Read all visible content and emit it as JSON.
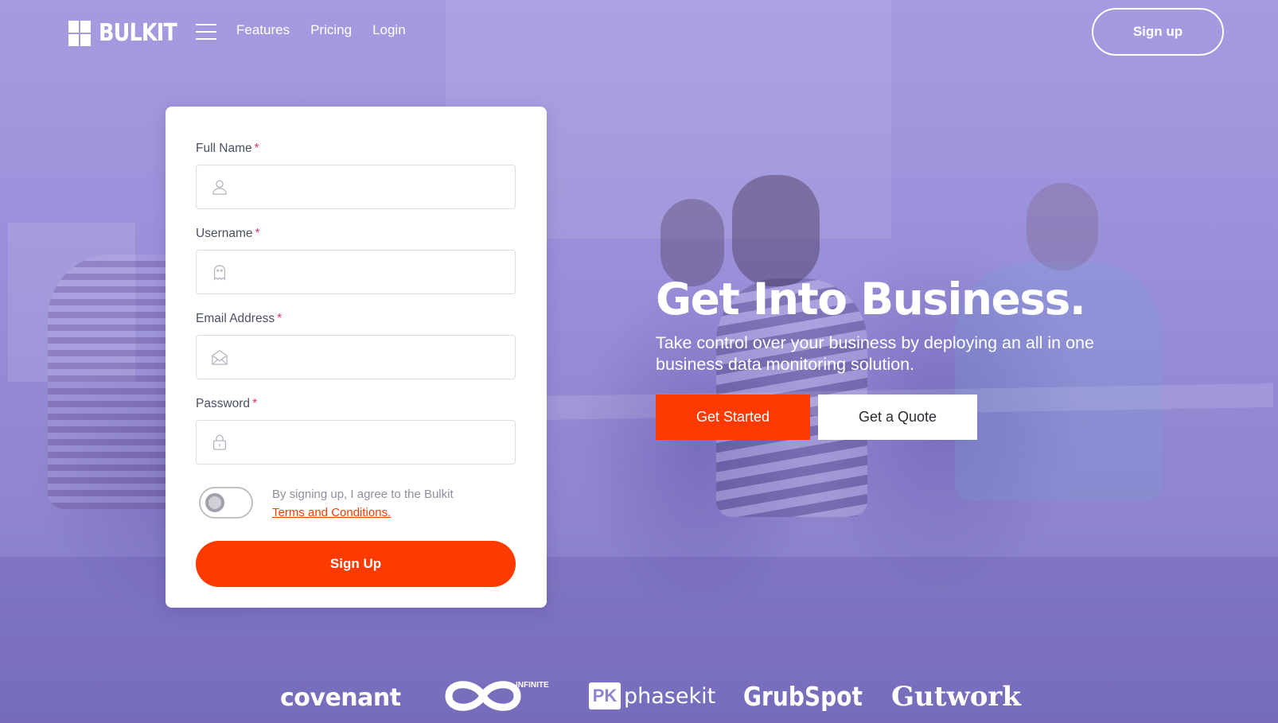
{
  "nav": {
    "brand": "BULKIT",
    "links": [
      "Features",
      "Pricing",
      "Login"
    ],
    "signup_label": "Sign up"
  },
  "form": {
    "fields": [
      {
        "label": "Full Name",
        "required_mark": "*",
        "icon": "user-icon",
        "value": "",
        "placeholder": ""
      },
      {
        "label": "Username",
        "required_mark": "*",
        "icon": "ghost-icon",
        "value": "",
        "placeholder": ""
      },
      {
        "label": "Email Address",
        "required_mark": "*",
        "icon": "envelope-icon",
        "value": "",
        "placeholder": ""
      },
      {
        "label": "Password",
        "required_mark": "*",
        "icon": "lock-icon",
        "value": "",
        "placeholder": ""
      }
    ],
    "agree_text": "By signing up, I agree to the Bulkit",
    "terms_link": "Terms and Conditions.",
    "toggle_on": false,
    "submit_label": "Sign Up"
  },
  "hero": {
    "title": "Get Into Business.",
    "subtitle": "Take control over your business by deploying an all in one business data monitoring solution.",
    "primary_cta": "Get Started",
    "secondary_cta": "Get a Quote"
  },
  "clients": {
    "logos": [
      "covenant",
      "INFINITE",
      "phasekit",
      "GrubSpot",
      "Gutwork"
    ],
    "phasekit_mark": "PK"
  },
  "colors": {
    "accent": "#ff3a00",
    "overlay": "#8f86cf",
    "required": "#e5316b",
    "card": "#ffffff"
  }
}
